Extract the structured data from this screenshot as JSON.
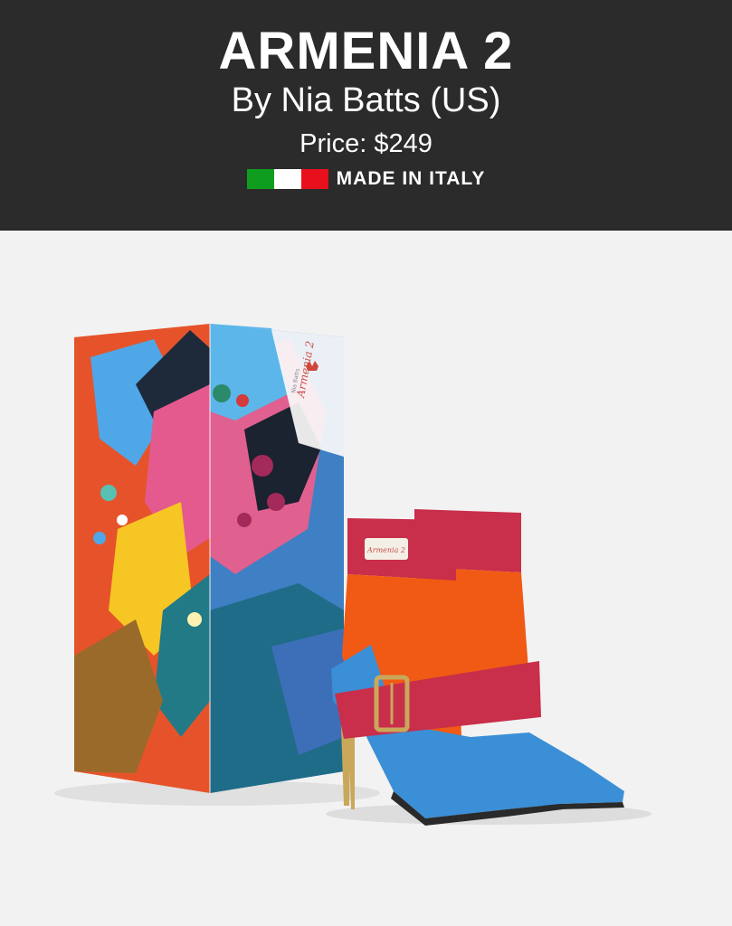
{
  "product": {
    "title": "ARMENIA 2",
    "byline": "By Nia Batts (US)",
    "price": "Price: $249",
    "made_in": "MADE IN ITALY",
    "flag_colors": [
      "#0f9d1f",
      "#ffffff",
      "#e8101c"
    ]
  },
  "box_print": {
    "brand_script": "Armenia 2",
    "small_text": "Nia Batts"
  },
  "shoe_tag": {
    "brand_script": "Armenia 2"
  },
  "colors": {
    "header_bg": "#2b2b2b",
    "page_bg": "#f2f2f2",
    "shoe_blue": "#3a8fd6",
    "shoe_orange": "#f05a14",
    "shoe_red": "#c92e4a",
    "heel_gold": "#c9a85b"
  }
}
